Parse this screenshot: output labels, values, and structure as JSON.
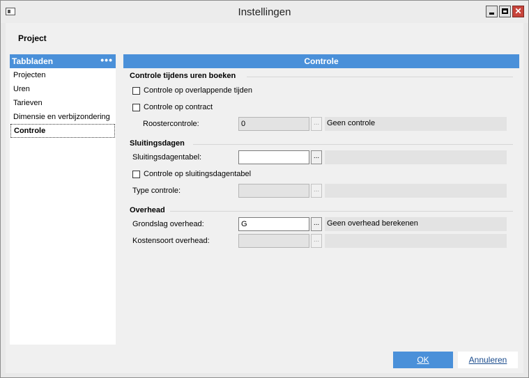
{
  "window": {
    "title": "Instellingen",
    "close_glyph": "✕"
  },
  "section_title": "Project",
  "sidebar": {
    "header": "Tabbladen",
    "menu_glyph": "•••",
    "items": [
      {
        "label": "Projecten"
      },
      {
        "label": "Uren"
      },
      {
        "label": "Tarieven"
      },
      {
        "label": "Dimensie en verbijzondering"
      },
      {
        "label": "Controle",
        "active": true
      }
    ]
  },
  "panel": {
    "title": "Controle",
    "ellipsis": "...",
    "groups": {
      "uren": {
        "title": "Controle tijdens uren boeken",
        "overlap_label": "Controle op overlappende tijden",
        "contract_label": "Controle op contract",
        "rooster_label": "Roostercontrole:",
        "rooster_value": "0",
        "rooster_desc": "Geen controle"
      },
      "sluiting": {
        "title": "Sluitingsdagen",
        "tabel_label": "Sluitingsdagentabel:",
        "tabel_value": "",
        "check_label": "Controle op sluitingsdagentabel",
        "type_label": "Type controle:",
        "type_value": ""
      },
      "overhead": {
        "title": "Overhead",
        "grondslag_label": "Grondslag overhead:",
        "grondslag_value": "G",
        "grondslag_desc": "Geen overhead berekenen",
        "kosten_label": "Kostensoort overhead:",
        "kosten_value": ""
      }
    }
  },
  "buttons": {
    "ok": "OK",
    "cancel": "Annuleren"
  },
  "colors": {
    "accent": "#4a90d9",
    "close": "#c7443b"
  }
}
